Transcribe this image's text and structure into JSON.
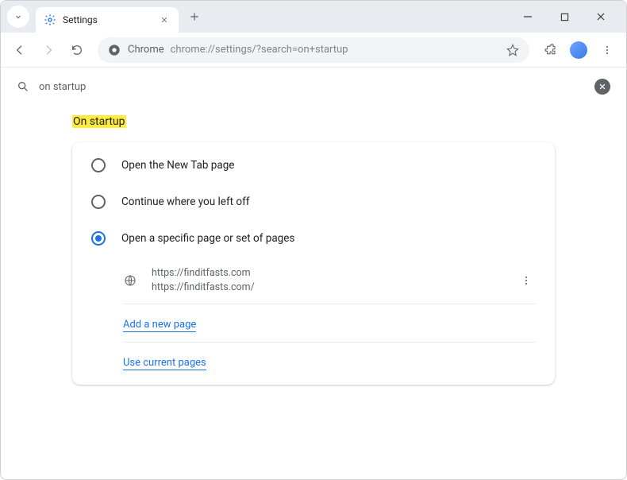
{
  "window": {
    "tab_title": "Settings"
  },
  "toolbar": {
    "omnibox_label": "Chrome",
    "omnibox_url": "chrome://settings/?search=on+startup"
  },
  "search": {
    "query": "on startup"
  },
  "section": {
    "title": "On startup"
  },
  "options": {
    "opt1": "Open the New Tab page",
    "opt2": "Continue where you left off",
    "opt3": "Open a specific page or set of pages"
  },
  "pages": [
    {
      "title": "https://finditfasts.com",
      "url": "https://finditfasts.com/"
    }
  ],
  "links": {
    "add": "Add a new page",
    "use_current": "Use current pages"
  }
}
